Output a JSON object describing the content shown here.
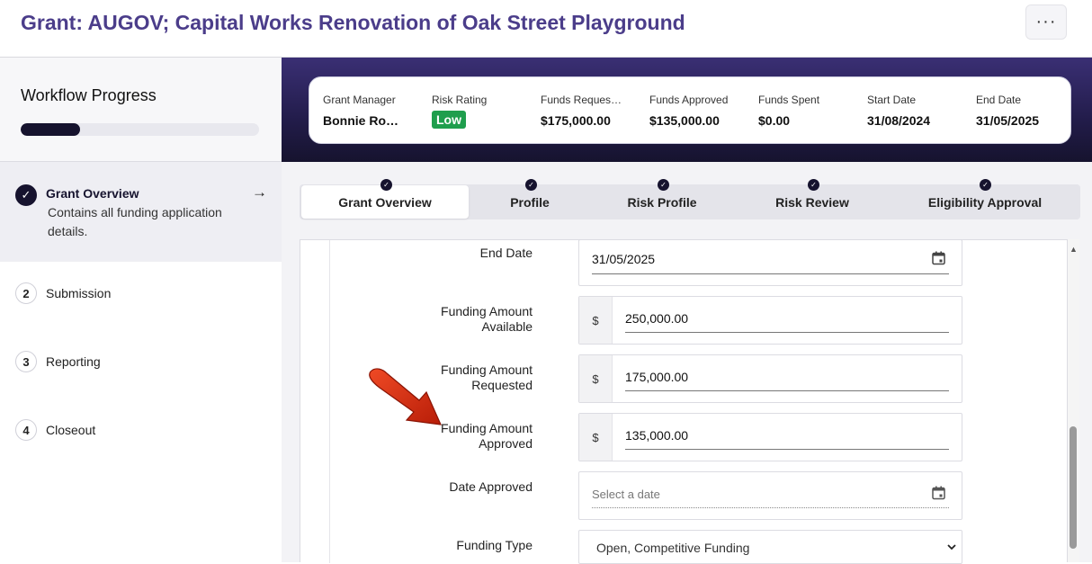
{
  "header": {
    "title": "Grant: AUGOV; Capital Works Renovation of Oak Street Playground",
    "more_label": "···"
  },
  "workflow": {
    "title": "Workflow Progress",
    "progress_fraction": 0.25
  },
  "steps": [
    {
      "badge": "✓",
      "label": "Grant Overview",
      "description": "Contains all funding application details.",
      "arrow": "→"
    },
    {
      "badge": "2",
      "label": "Submission"
    },
    {
      "badge": "3",
      "label": "Reporting"
    },
    {
      "badge": "4",
      "label": "Closeout"
    }
  ],
  "summary": {
    "grant_manager": {
      "label": "Grant Manager",
      "value": "Bonnie Ro…"
    },
    "risk_rating": {
      "label": "Risk Rating",
      "value": "Low"
    },
    "funds_requested": {
      "label": "Funds Reques…",
      "value": "$175,000.00"
    },
    "funds_approved": {
      "label": "Funds Approved",
      "value": "$135,000.00"
    },
    "funds_spent": {
      "label": "Funds Spent",
      "value": "$0.00"
    },
    "start_date": {
      "label": "Start Date",
      "value": "31/08/2024"
    },
    "end_date": {
      "label": "End Date",
      "value": "31/05/2025"
    }
  },
  "tabs": [
    {
      "label": "Grant Overview",
      "check": "✓"
    },
    {
      "label": "Profile",
      "check": "✓"
    },
    {
      "label": "Risk Profile",
      "check": "✓"
    },
    {
      "label": "Risk Review",
      "check": "✓"
    },
    {
      "label": "Eligibility Approval",
      "check": "✓"
    }
  ],
  "form": {
    "end_date": {
      "label": "End Date",
      "value": "31/05/2025"
    },
    "funding_available": {
      "label_1": "Funding Amount",
      "label_2": "Available",
      "prefix": "$",
      "value": "250,000.00"
    },
    "funding_requested": {
      "label_1": "Funding Amount",
      "label_2": "Requested",
      "prefix": "$",
      "value": "175,000.00"
    },
    "funding_approved": {
      "label_1": "Funding Amount",
      "label_2": "Approved",
      "prefix": "$",
      "value": "135,000.00"
    },
    "date_approved": {
      "label": "Date Approved",
      "placeholder": "Select a date"
    },
    "funding_type": {
      "label": "Funding Type",
      "value": "Open, Competitive Funding"
    }
  },
  "colors": {
    "accent": "#4b3d8a",
    "dark": "#16132e",
    "success": "#1f9e4d",
    "annotation_arrow": "#d62e10"
  }
}
